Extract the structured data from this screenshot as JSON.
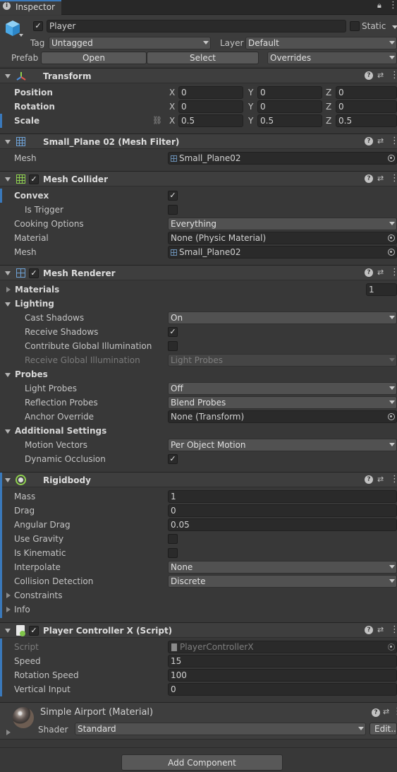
{
  "tab": {
    "label": "Inspector"
  },
  "object": {
    "name": "Player",
    "static_label": "Static",
    "tag_label": "Tag",
    "tag_value": "Untagged",
    "layer_label": "Layer",
    "layer_value": "Default",
    "prefab_label": "Prefab",
    "open_label": "Open",
    "select_label": "Select",
    "overrides_label": "Overrides"
  },
  "transform": {
    "title": "Transform",
    "rows": [
      {
        "label": "Position",
        "x": "0",
        "y": "0",
        "z": "0"
      },
      {
        "label": "Rotation",
        "x": "0",
        "y": "0",
        "z": "0"
      },
      {
        "label": "Scale",
        "x": "0.5",
        "y": "0.5",
        "z": "0.5"
      }
    ],
    "axis_x": "X",
    "axis_y": "Y",
    "axis_z": "Z"
  },
  "mesh_filter": {
    "title": "Small_Plane 02 (Mesh Filter)",
    "mesh_label": "Mesh",
    "mesh_value": "Small_Plane02"
  },
  "mesh_collider": {
    "title": "Mesh Collider",
    "convex_label": "Convex",
    "trigger_label": "Is Trigger",
    "cooking_label": "Cooking Options",
    "cooking_value": "Everything",
    "material_label": "Material",
    "material_value": "None (Physic Material)",
    "mesh_label": "Mesh",
    "mesh_value": "Small_Plane02"
  },
  "mesh_renderer": {
    "title": "Mesh Renderer",
    "materials_label": "Materials",
    "materials_count": "1",
    "lighting_label": "Lighting",
    "cast_shadows_label": "Cast Shadows",
    "cast_shadows_value": "On",
    "receive_shadows_label": "Receive Shadows",
    "contribute_gi_label": "Contribute Global Illumination",
    "receive_gi_label": "Receive Global Illumination",
    "receive_gi_value": "Light Probes",
    "probes_label": "Probes",
    "light_probes_label": "Light Probes",
    "light_probes_value": "Off",
    "reflection_probes_label": "Reflection Probes",
    "reflection_probes_value": "Blend Probes",
    "anchor_label": "Anchor Override",
    "anchor_value": "None (Transform)",
    "additional_label": "Additional Settings",
    "motion_vectors_label": "Motion Vectors",
    "motion_vectors_value": "Per Object Motion",
    "dynamic_occlusion_label": "Dynamic Occlusion"
  },
  "rigidbody": {
    "title": "Rigidbody",
    "mass_label": "Mass",
    "mass_value": "1",
    "drag_label": "Drag",
    "drag_value": "0",
    "angular_drag_label": "Angular Drag",
    "angular_drag_value": "0.05",
    "use_gravity_label": "Use Gravity",
    "kinematic_label": "Is Kinematic",
    "interpolate_label": "Interpolate",
    "interpolate_value": "None",
    "collision_label": "Collision Detection",
    "collision_value": "Discrete",
    "constraints_label": "Constraints",
    "info_label": "Info"
  },
  "script": {
    "title": "Player Controller X (Script)",
    "script_label": "Script",
    "script_value": "PlayerControllerX",
    "speed_label": "Speed",
    "speed_value": "15",
    "rotation_speed_label": "Rotation Speed",
    "rotation_speed_value": "100",
    "vertical_input_label": "Vertical Input",
    "vertical_input_value": "0"
  },
  "material": {
    "title": "Simple Airport (Material)",
    "shader_label": "Shader",
    "shader_value": "Standard",
    "edit_label": "Edit..."
  },
  "add_component_label": "Add Component",
  "colors": {
    "accent": "#3a79bb",
    "background": "#383838",
    "header": "#3e3e3e"
  }
}
